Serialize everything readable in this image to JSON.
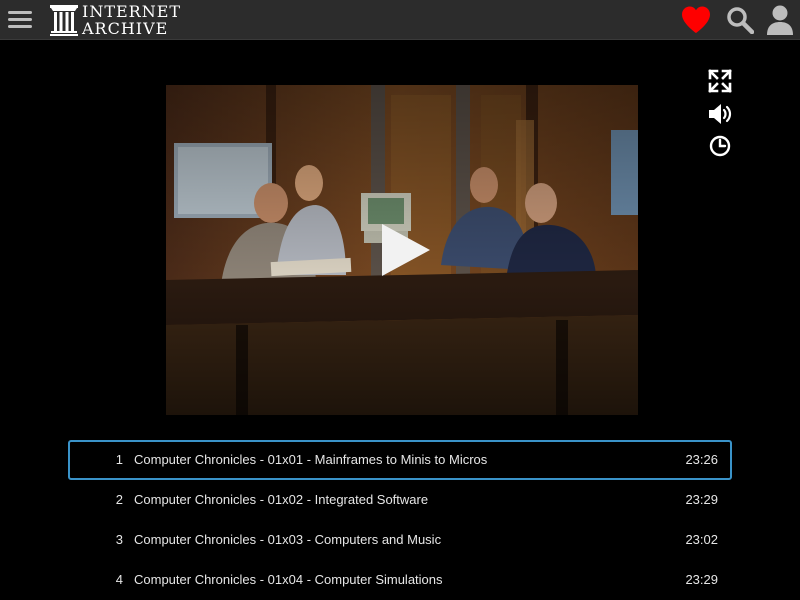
{
  "header": {
    "logo_line1": "INTERNET",
    "logo_line2": "ARCHIVE",
    "icons": [
      "hamburger-menu-icon",
      "archive-building-icon",
      "heart-icon",
      "search-icon",
      "user-icon"
    ],
    "heart_color": "#ff0000"
  },
  "player": {
    "controls": [
      "fullscreen-icon",
      "volume-icon",
      "playback-speed-icon",
      "play-icon"
    ],
    "accent_color": "#3a93c9"
  },
  "playlist": [
    {
      "num": "1",
      "title": "Computer Chronicles - 01x01 - Mainframes to Minis to Micros",
      "duration": "23:26",
      "active": true
    },
    {
      "num": "2",
      "title": "Computer Chronicles - 01x02 - Integrated Software",
      "duration": "23:29",
      "active": false
    },
    {
      "num": "3",
      "title": "Computer Chronicles - 01x03 - Computers and Music",
      "duration": "23:02",
      "active": false
    },
    {
      "num": "4",
      "title": "Computer Chronicles - 01x04 - Computer Simulations",
      "duration": "23:29",
      "active": false
    }
  ]
}
